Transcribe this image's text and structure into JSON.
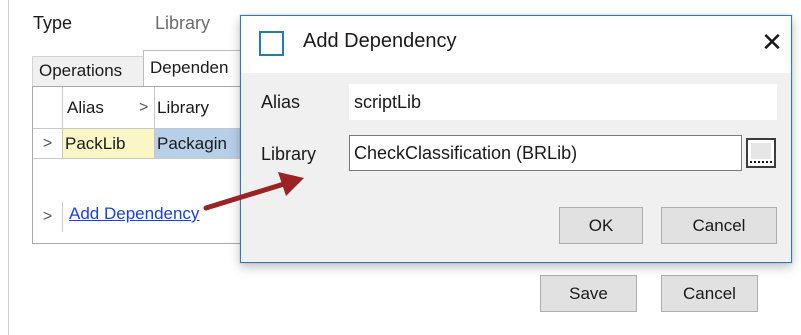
{
  "editor": {
    "type_label": "Type",
    "type_value": "Library",
    "tabs": [
      {
        "label": "Operations"
      },
      {
        "label": "Dependencies",
        "visible_text": "Dependen"
      }
    ],
    "grid": {
      "columns": [
        {
          "label": "Alias"
        },
        {
          "label": "Library"
        }
      ],
      "rows": [
        {
          "expander": ">",
          "alias": "PackLib",
          "library": "Packagin"
        }
      ],
      "add_row_glyph": ">",
      "add_dependency_link": "Add Dependency",
      "sort_glyph": ">"
    },
    "save_label": "Save",
    "cancel_label": "Cancel"
  },
  "dialog": {
    "title": "Add Dependency",
    "close_glyph": "✕",
    "alias_label": "Alias",
    "alias_value": "scriptLib",
    "library_label": "Library",
    "library_value": "CheckClassification (BRLib)",
    "ok_label": "OK",
    "cancel_label": "Cancel",
    "icons": [
      "app-window-icon",
      "browse-ellipsis-icon",
      "close-icon"
    ]
  },
  "colors": {
    "dialog_border": "#2b78c8",
    "link": "#1a43d6",
    "alias_cell_bg": "#fbf6c6",
    "library_cell_bg": "#b8cfe9",
    "arrow": "#9b2323"
  }
}
